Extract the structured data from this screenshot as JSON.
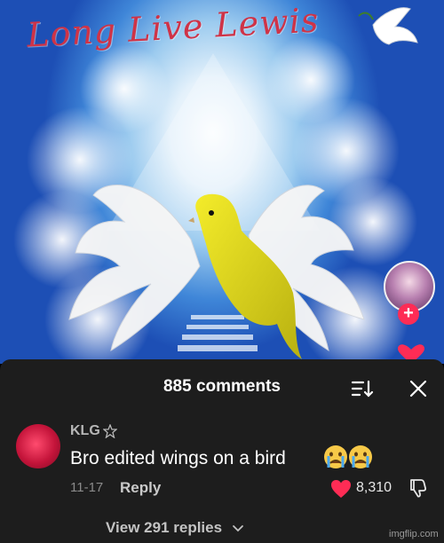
{
  "video": {
    "title": "Long Live Lewis"
  },
  "comments_sheet": {
    "title": "885 comments",
    "comment": {
      "username": "KLG",
      "text": "Bro edited wings on a bird",
      "emoji": [
        "crying-face-emoji",
        "crying-face-emoji"
      ],
      "date": "11-17",
      "reply_label": "Reply",
      "like_count": "8,310",
      "liked": true
    },
    "view_replies": "View 291 replies"
  },
  "watermark": "imgflip.com",
  "colors": {
    "sheet_background": "#1d1d1d",
    "like_red": "#fe2c55",
    "title_red": "#cf3347",
    "bird_yellow": "#e6de1a"
  }
}
